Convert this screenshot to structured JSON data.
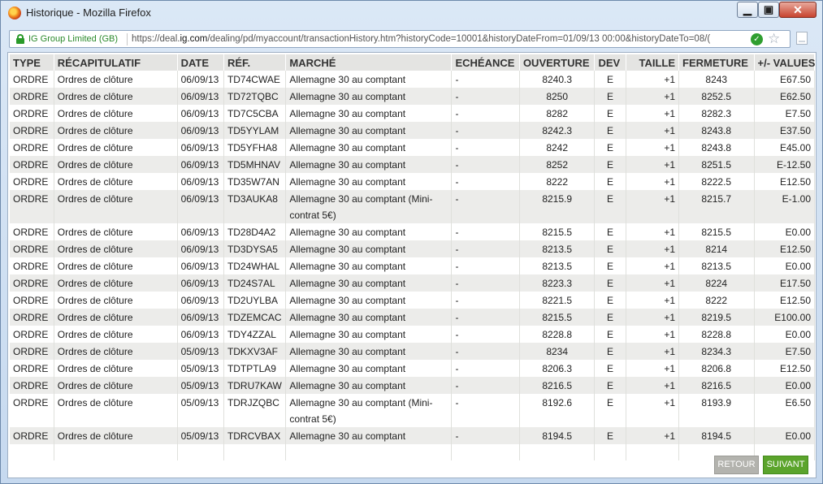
{
  "window": {
    "title": "Historique - Mozilla Firefox"
  },
  "urlbar": {
    "identity": "IG Group Limited (GB)",
    "url_prefix": "https://deal.",
    "url_domain": "ig.com",
    "url_rest": "/dealing/pd/myaccount/transactionHistory.htm?historyCode=10001&historyDateFrom=01/09/13 00:00&historyDateTo=08/("
  },
  "table": {
    "headers": [
      "TYPE",
      "RÉCAPITULATIF",
      "DATE",
      "RÉF.",
      "MARCHÉ",
      "ECHÉANCE",
      "OUVERTURE",
      "DEV",
      "TAILLE",
      "FERMETURE",
      "+/- VALUES"
    ],
    "rows": [
      [
        "ORDRE",
        "Ordres de clôture",
        "06/09/13",
        "TD74CWAE",
        "Allemagne 30 au comptant",
        "-",
        "8240.3",
        "E",
        "+1",
        "8243",
        "E67.50"
      ],
      [
        "ORDRE",
        "Ordres de clôture",
        "06/09/13",
        "TD72TQBC",
        "Allemagne 30 au comptant",
        "-",
        "8250",
        "E",
        "+1",
        "8252.5",
        "E62.50"
      ],
      [
        "ORDRE",
        "Ordres de clôture",
        "06/09/13",
        "TD7C5CBA",
        "Allemagne 30 au comptant",
        "-",
        "8282",
        "E",
        "+1",
        "8282.3",
        "E7.50"
      ],
      [
        "ORDRE",
        "Ordres de clôture",
        "06/09/13",
        "TD5YYLAM",
        "Allemagne 30 au comptant",
        "-",
        "8242.3",
        "E",
        "+1",
        "8243.8",
        "E37.50"
      ],
      [
        "ORDRE",
        "Ordres de clôture",
        "06/09/13",
        "TD5YFHA8",
        "Allemagne 30 au comptant",
        "-",
        "8242",
        "E",
        "+1",
        "8243.8",
        "E45.00"
      ],
      [
        "ORDRE",
        "Ordres de clôture",
        "06/09/13",
        "TD5MHNAV",
        "Allemagne 30 au comptant",
        "-",
        "8252",
        "E",
        "+1",
        "8251.5",
        "E-12.50"
      ],
      [
        "ORDRE",
        "Ordres de clôture",
        "06/09/13",
        "TD35W7AN",
        "Allemagne 30 au comptant",
        "-",
        "8222",
        "E",
        "+1",
        "8222.5",
        "E12.50"
      ],
      [
        "ORDRE",
        "Ordres de clôture",
        "06/09/13",
        "TD3AUKA8",
        "Allemagne 30 au comptant (Mini-contrat 5€)",
        "-",
        "8215.9",
        "E",
        "+1",
        "8215.7",
        "E-1.00"
      ],
      [
        "ORDRE",
        "Ordres de clôture",
        "06/09/13",
        "TD28D4A2",
        "Allemagne 30 au comptant",
        "-",
        "8215.5",
        "E",
        "+1",
        "8215.5",
        "E0.00"
      ],
      [
        "ORDRE",
        "Ordres de clôture",
        "06/09/13",
        "TD3DYSA5",
        "Allemagne 30 au comptant",
        "-",
        "8213.5",
        "E",
        "+1",
        "8214",
        "E12.50"
      ],
      [
        "ORDRE",
        "Ordres de clôture",
        "06/09/13",
        "TD24WHAL",
        "Allemagne 30 au comptant",
        "-",
        "8213.5",
        "E",
        "+1",
        "8213.5",
        "E0.00"
      ],
      [
        "ORDRE",
        "Ordres de clôture",
        "06/09/13",
        "TD24S7AL",
        "Allemagne 30 au comptant",
        "-",
        "8223.3",
        "E",
        "+1",
        "8224",
        "E17.50"
      ],
      [
        "ORDRE",
        "Ordres de clôture",
        "06/09/13",
        "TD2UYLBA",
        "Allemagne 30 au comptant",
        "-",
        "8221.5",
        "E",
        "+1",
        "8222",
        "E12.50"
      ],
      [
        "ORDRE",
        "Ordres de clôture",
        "06/09/13",
        "TDZEMCAC",
        "Allemagne 30 au comptant",
        "-",
        "8215.5",
        "E",
        "+1",
        "8219.5",
        "E100.00"
      ],
      [
        "ORDRE",
        "Ordres de clôture",
        "06/09/13",
        "TDY4ZZAL",
        "Allemagne 30 au comptant",
        "-",
        "8228.8",
        "E",
        "+1",
        "8228.8",
        "E0.00"
      ],
      [
        "ORDRE",
        "Ordres de clôture",
        "05/09/13",
        "TDKXV3AF",
        "Allemagne 30 au comptant",
        "-",
        "8234",
        "E",
        "+1",
        "8234.3",
        "E7.50"
      ],
      [
        "ORDRE",
        "Ordres de clôture",
        "05/09/13",
        "TDTPTLA9",
        "Allemagne 30 au comptant",
        "-",
        "8206.3",
        "E",
        "+1",
        "8206.8",
        "E12.50"
      ],
      [
        "ORDRE",
        "Ordres de clôture",
        "05/09/13",
        "TDRU7KAW",
        "Allemagne 30 au comptant",
        "-",
        "8216.5",
        "E",
        "+1",
        "8216.5",
        "E0.00"
      ],
      [
        "ORDRE",
        "Ordres de clôture",
        "05/09/13",
        "TDRJZQBC",
        "Allemagne 30 au comptant (Mini-contrat 5€)",
        "-",
        "8192.6",
        "E",
        "+1",
        "8193.9",
        "E6.50"
      ],
      [
        "ORDRE",
        "Ordres de clôture",
        "05/09/13",
        "TDRCVBAX",
        "Allemagne 30 au comptant",
        "-",
        "8194.5",
        "E",
        "+1",
        "8194.5",
        "E0.00"
      ]
    ]
  },
  "buttons": {
    "prev": "RETOUR",
    "next": "SUIVANT"
  },
  "colors": {
    "next_button": "#5ba42c",
    "prev_button": "#b3b3ae",
    "secure_green": "#2a9a2a"
  }
}
